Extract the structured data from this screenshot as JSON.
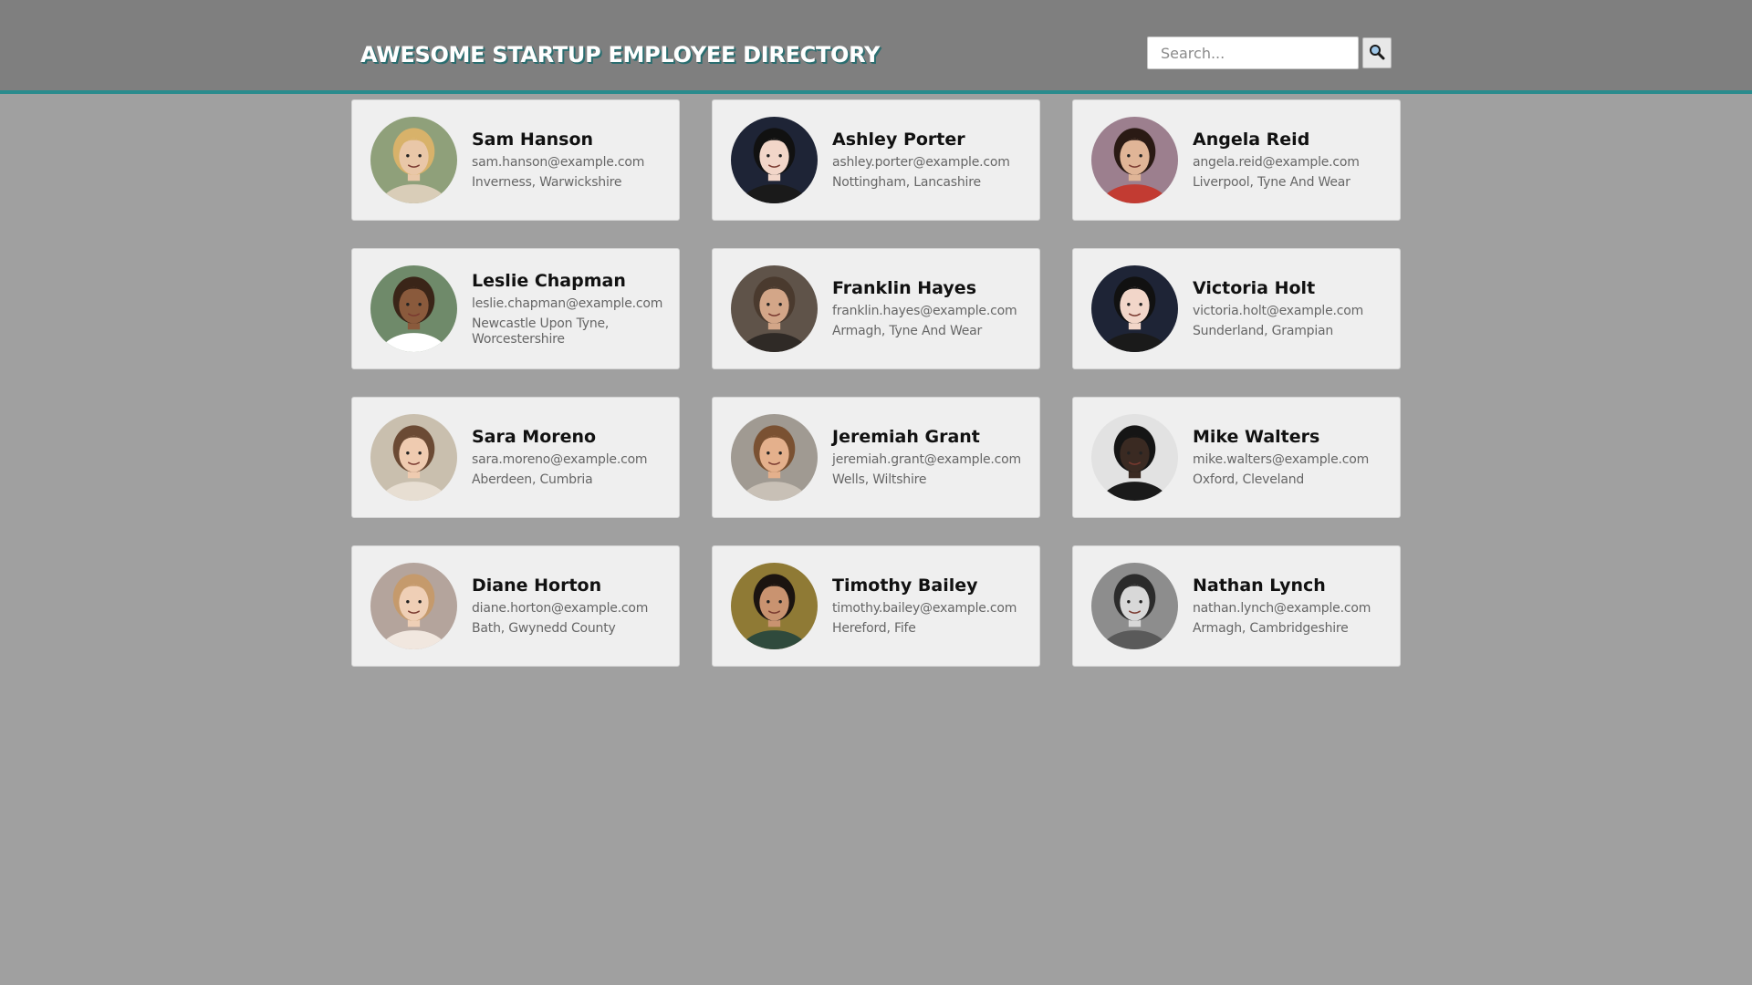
{
  "header": {
    "title": "AWESOME STARTUP EMPLOYEE DIRECTORY",
    "search_placeholder": "Search...",
    "search_icon": "magnifier-icon"
  },
  "employees": [
    {
      "name": "Sam Hanson",
      "email": "sam.hanson@example.com",
      "location": "Inverness, Warwickshire",
      "avatar": {
        "bg": "#8fa07a",
        "skin": "#e9c7a8",
        "hair": "#d8b26a",
        "shirt": "#d9cdb8"
      }
    },
    {
      "name": "Ashley Porter",
      "email": "ashley.porter@example.com",
      "location": "Nottingham, Lancashire",
      "avatar": {
        "bg": "#1e2436",
        "skin": "#f2d6c9",
        "hair": "#111111",
        "shirt": "#1a1a1a"
      }
    },
    {
      "name": "Angela Reid",
      "email": "angela.reid@example.com",
      "location": "Liverpool, Tyne And Wear",
      "avatar": {
        "bg": "#9c7f8e",
        "skin": "#e0b597",
        "hair": "#2a1a14",
        "shirt": "#c23b32"
      }
    },
    {
      "name": "Leslie Chapman",
      "email": "leslie.chapman@example.com",
      "location": "Newcastle Upon Tyne, Worcestershire",
      "avatar": {
        "bg": "#6f8a6a",
        "skin": "#8a5a3c",
        "hair": "#3a2518",
        "shirt": "#ffffff"
      }
    },
    {
      "name": "Franklin Hayes",
      "email": "franklin.hayes@example.com",
      "location": "Armagh, Tyne And Wear",
      "avatar": {
        "bg": "#5f5349",
        "skin": "#d3a688",
        "hair": "#4a3a2e",
        "shirt": "#2f2a26"
      }
    },
    {
      "name": "Victoria Holt",
      "email": "victoria.holt@example.com",
      "location": "Sunderland, Grampian",
      "avatar": {
        "bg": "#1e2436",
        "skin": "#f2d6c9",
        "hair": "#111111",
        "shirt": "#1a1a1a"
      }
    },
    {
      "name": "Sara Moreno",
      "email": "sara.moreno@example.com",
      "location": "Aberdeen, Cumbria",
      "avatar": {
        "bg": "#c9bfae",
        "skin": "#efcbb0",
        "hair": "#6b4a34",
        "shirt": "#e7ded2"
      }
    },
    {
      "name": "Jeremiah Grant",
      "email": "jeremiah.grant@example.com",
      "location": "Wells, Wiltshire",
      "avatar": {
        "bg": "#a09a92",
        "skin": "#e4b08c",
        "hair": "#7a5132",
        "shirt": "#c8c0b6"
      }
    },
    {
      "name": "Mike Walters",
      "email": "mike.walters@example.com",
      "location": "Oxford, Cleveland",
      "avatar": {
        "bg": "#e2e2e2",
        "skin": "#3a2a22",
        "hair": "#151515",
        "shirt": "#1a1a1a"
      }
    },
    {
      "name": "Diane Horton",
      "email": "diane.horton@example.com",
      "location": "Bath, Gwynedd County",
      "avatar": {
        "bg": "#b4a49c",
        "skin": "#efcfb6",
        "hair": "#c59a6c",
        "shirt": "#f1e7df"
      }
    },
    {
      "name": "Timothy Bailey",
      "email": "timothy.bailey@example.com",
      "location": "Hereford, Fife",
      "avatar": {
        "bg": "#8f7a35",
        "skin": "#c99370",
        "hair": "#1b1410",
        "shirt": "#2f4a3c"
      }
    },
    {
      "name": "Nathan Lynch",
      "email": "nathan.lynch@example.com",
      "location": "Armagh, Cambridgeshire",
      "avatar": {
        "bg": "#8d8d8d",
        "skin": "#d8d8d8",
        "hair": "#2b2b2b",
        "shirt": "#5a5a5a"
      }
    }
  ]
}
